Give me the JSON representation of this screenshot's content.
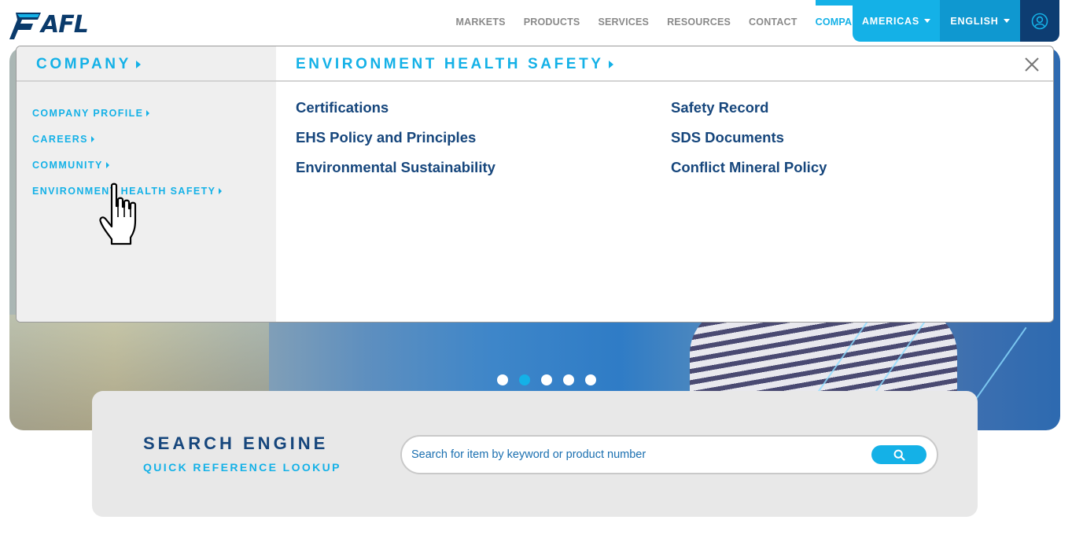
{
  "brand": {
    "logo_text": "AFL",
    "accent": "#14b1e7",
    "navy": "#16467c"
  },
  "nav": {
    "items": [
      {
        "label": "MARKETS"
      },
      {
        "label": "PRODUCTS"
      },
      {
        "label": "SERVICES"
      },
      {
        "label": "RESOURCES"
      },
      {
        "label": "CONTACT"
      },
      {
        "label": "COMPANY",
        "active": true
      }
    ],
    "region": "AMERICAS",
    "language": "ENGLISH",
    "user_icon": "user-icon"
  },
  "mega_menu": {
    "left_title": "COMPANY",
    "right_title": "ENVIRONMENT HEALTH SAFETY",
    "side_links": [
      {
        "label": "COMPANY PROFILE"
      },
      {
        "label": "CAREERS"
      },
      {
        "label": "COMMUNITY"
      },
      {
        "label": "ENVIRONMENT HEALTH SAFETY"
      }
    ],
    "col1": [
      {
        "label": "Certifications"
      },
      {
        "label": "EHS Policy and Principles"
      },
      {
        "label": "Environmental Sustainability"
      }
    ],
    "col2": [
      {
        "label": "Safety Record"
      },
      {
        "label": "SDS Documents"
      },
      {
        "label": "Conflict Mineral Policy"
      }
    ],
    "close_icon": "close-icon"
  },
  "carousel": {
    "slide_count": 5,
    "active_index": 1
  },
  "search": {
    "title": "SEARCH ENGINE",
    "subtitle": "QUICK REFERENCE LOOKUP",
    "placeholder": "Search for item by keyword or product number",
    "value": "",
    "button_icon": "search-icon"
  }
}
